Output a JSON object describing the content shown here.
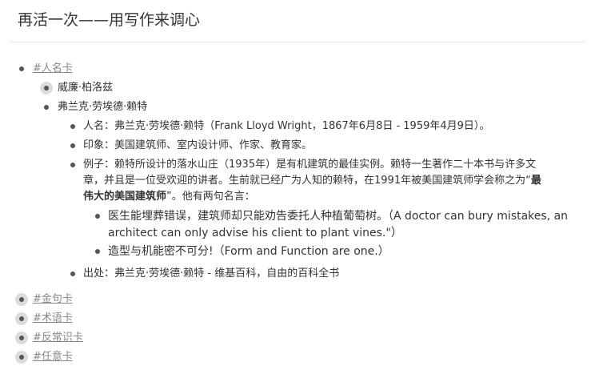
{
  "page_title": "再活一次——用写作来调心",
  "outline": {
    "root_tag": "#人名卡",
    "person1": "威廉·柏洛兹",
    "person2": "弗兰克·劳埃德·赖特",
    "details": {
      "name": "人名：弗兰克·劳埃德·赖特（Frank Lloyd Wright，1867年6月8日 - 1959年4月9日）。",
      "impression": "印象：美国建筑师、室内设计师、作家、教育家。",
      "example_line1": "例子：赖特所设计的落水山庄（1935年）是有机建筑的最佳实例。赖特一生著作二十本书与许多文",
      "example_line2_pre": "章，并且是一位受欢迎的讲者。生前就已经广为人知的赖特，在1991年被美国建筑师学会称之为“",
      "example_bold_a": "最",
      "example_bold_b": "伟大的美国建筑师",
      "example_line3_post": "”。他有两句名言：",
      "quote1_line1": "医生能埋葬错误，建筑师却只能劝告委托人种植葡萄树。（A doctor can bury mistakes, an",
      "quote1_line2": "architect can only advise his client to plant vines.\"）",
      "quote2": "造型与机能密不可分!（Form and Function are one.）",
      "source": "出处：弗兰克·劳埃德·赖特 - 维基百科，自由的百科全书"
    },
    "other_tags": [
      "#金句卡",
      "#术语卡",
      "#反常识卡",
      "#任意卡"
    ]
  },
  "icons": {
    "bullet": "bullet-dot-icon",
    "collapsed_bullet": "collapsed-bullet-icon"
  }
}
